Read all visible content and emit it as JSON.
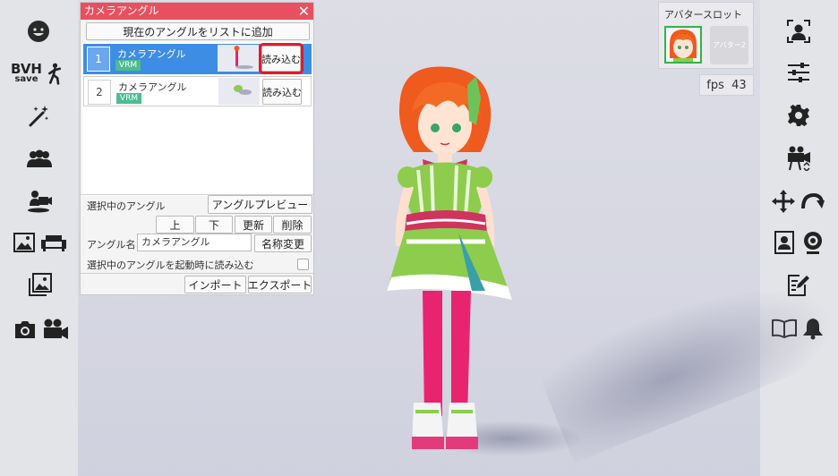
{
  "left_sidebar": {
    "bvh_label": "BVH",
    "bvh_save_label": "save"
  },
  "camera_window": {
    "title": "カメラアングル",
    "close": "✕",
    "add_button": "現在のアングルをリストに追加",
    "rows": [
      {
        "number": "1",
        "name": "カメラアングル",
        "tag": "VRM",
        "load": "読み込む"
      },
      {
        "number": "2",
        "name": "カメラアングル",
        "tag": "VRM",
        "load": "読み込む"
      }
    ],
    "selected_label": "選択中のアングル",
    "preview_button": "アングルプレビュー",
    "up_button": "上",
    "down_button": "下",
    "update_button": "更新",
    "delete_button": "削除",
    "name_label": "アングル名",
    "name_value": "カメラアングル",
    "rename_button": "名称変更",
    "startup_label": "選択中のアングルを起動時に読み込む",
    "import_button": "インポート",
    "export_button": "エクスポート"
  },
  "avatar_slot": {
    "title": "アバタースロット",
    "slot2": "アバター2"
  },
  "fps": {
    "label": "fps",
    "value": "43"
  },
  "colors": {
    "title_bar": "#e8505f",
    "selected_row": "#3d8de4",
    "tag": "#4bbd8f",
    "highlight": "#e11a2a",
    "avatar_border": "#33b24c"
  }
}
